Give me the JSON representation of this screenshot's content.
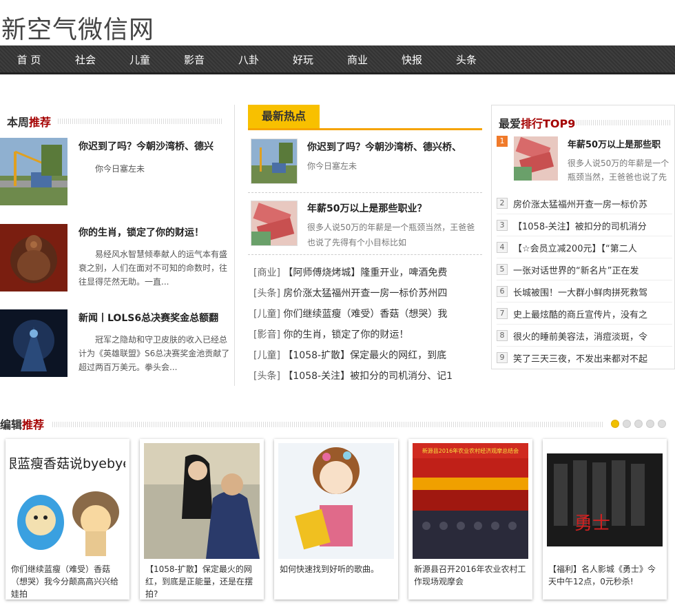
{
  "site": {
    "logo": "新空气微信网"
  },
  "nav": [
    "首 页",
    "社会",
    "儿童",
    "影音",
    "八卦",
    "好玩",
    "商业",
    "快报",
    "头条"
  ],
  "weekly": {
    "title_a": "本周",
    "title_b": "推荐",
    "items": [
      {
        "title": "你迟到了吗？今朝沙湾桥、德兴",
        "desc": "你今日塞左未"
      },
      {
        "title": "你的生肖，锁定了你的财运！",
        "desc": "易经风水智慧倾奉献人的运气本有盛衰之别，人们在面对不可知的命数时，往往显得茫然无助。一直..."
      },
      {
        "title": "新闻丨LOLS6总决赛奖金总额翻",
        "desc": "冠军之隐劫和守卫皮肤的收入已经总计为《英雄联盟》S6总决赛奖金池贡献了超过两百万美元。拳头会..."
      }
    ]
  },
  "hot": {
    "title": "最新热点",
    "cards": [
      {
        "title": "你迟到了吗？今朝沙湾桥、德兴桥、",
        "desc": "你今日塞左未"
      },
      {
        "title": "年薪50万以上是那些职业？",
        "desc": "很多人说50万的年薪是一个瓶颈当然，王爸爸也说了先得有个小目标比如"
      }
    ],
    "list": [
      {
        "cat": "[商业]",
        "text": "【阿师傅烧烤城】隆重开业，啤酒免费"
      },
      {
        "cat": "[头条]",
        "text": "房价涨太猛福州开查一房一标价苏州四"
      },
      {
        "cat": "[儿童]",
        "text": "你们继续蓝瘦（难受）香菇（想哭）我"
      },
      {
        "cat": "[影音]",
        "text": "你的生肖，锁定了你的财运！"
      },
      {
        "cat": "[儿童]",
        "text": "【1058-扩散】保定最火的网红，到底"
      },
      {
        "cat": "[头条]",
        "text": "【1058-关注】被扣分的司机消分、记1"
      }
    ]
  },
  "rank": {
    "title_a": "最爱",
    "title_b": "排行TOP9",
    "top": {
      "num": "1",
      "title": "年薪50万以上是那些职",
      "desc": "很多人说50万的年薪是一个瓶颈当然，王爸爸也说了先"
    },
    "items": [
      {
        "num": "2",
        "text": "房价涨太猛福州开查一房一标价苏"
      },
      {
        "num": "3",
        "text": "【1058-关注】被扣分的司机消分"
      },
      {
        "num": "4",
        "text": "【☆会员立减200元】【“第二人"
      },
      {
        "num": "5",
        "text": "一张对话世界的“新名片”正在发"
      },
      {
        "num": "6",
        "text": "长城被围！一大群小鲜肉拼死救驾"
      },
      {
        "num": "7",
        "text": "史上最炫酷的商丘宣传片，没有之"
      },
      {
        "num": "8",
        "text": "很火的睡前美容法，消痘淡斑，令"
      },
      {
        "num": "9",
        "text": "笑了三天三夜，不发出来都对不起"
      }
    ]
  },
  "editor": {
    "title_a": "编辑",
    "title_b": "推荐",
    "picks": [
      {
        "caption": "你们继续蓝瘦（难受）香菇（想哭）我今分颠高高兴兴给娃拍",
        "img_text": "跟蓝瘦香菇说byebye"
      },
      {
        "caption": "【1058-扩散】保定最火的网红，到底是正能量，还是在摆拍?",
        "img_text": ""
      },
      {
        "caption": "如何快速找到好听的歌曲。",
        "img_text": ""
      },
      {
        "caption": "新源县召开2016年农业农村工作现场观摩会",
        "img_text": "新源县2016年农业农村经济观摩总结会"
      },
      {
        "caption": "【福利】名人影城《勇士》今天中午12点，0元秒杀!",
        "img_text": "勇士"
      }
    ]
  }
}
